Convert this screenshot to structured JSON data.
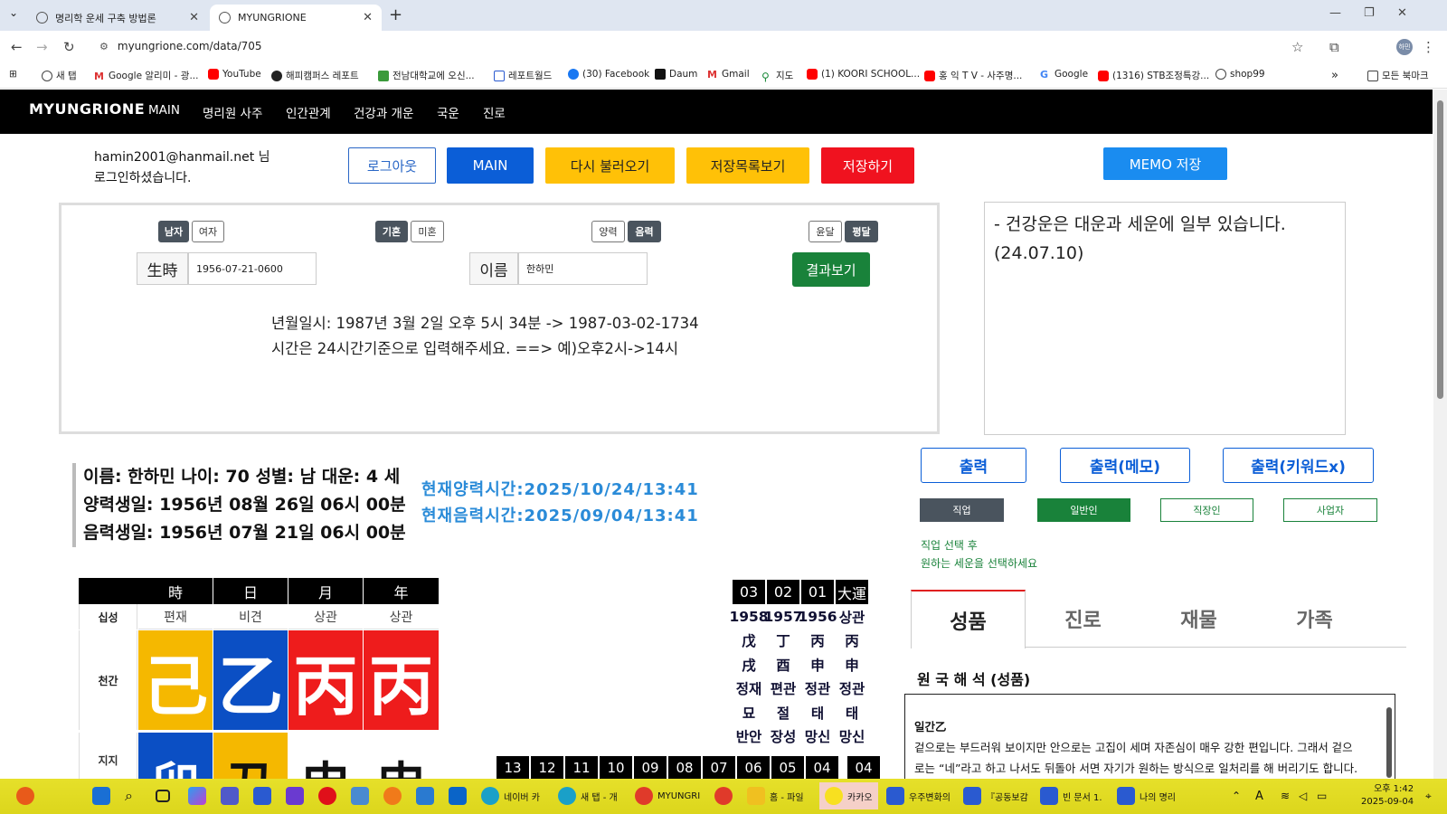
{
  "browser": {
    "tabs": [
      {
        "title": "명리학 운세 구축 방법론",
        "active": false
      },
      {
        "title": "MYUNGRIONE",
        "active": true
      }
    ],
    "url": "myungrione.com/data/705",
    "bookmarks": [
      "새 탭",
      "Google 알리미 - 광...",
      "YouTube",
      "해피캠퍼스 레포트",
      "전남대학교에 오신...",
      "레포트월드",
      "(30) Facebook",
      "Daum",
      "Gmail",
      "지도",
      "(1) KOORI SCHOOL...",
      "홍 익 T V - 사주명...",
      "Google",
      "(1316) STB조정특강...",
      "shop99"
    ],
    "bookmarks_more": "»",
    "all_bookmarks": "모든 북마크"
  },
  "site": {
    "brand": "MYUNGRIONE",
    "nav": [
      "MAIN",
      "명리원 사주",
      "인간관계",
      "건강과 개운",
      "국운",
      "진로"
    ]
  },
  "login": {
    "line1": "hamin2001@hanmail.net 님",
    "line2": "로그인하셨습니다."
  },
  "buttons": {
    "logout": "로그아웃",
    "main": "MAIN",
    "reload": "다시 불러오기",
    "savelist": "저장목록보기",
    "save": "저장하기",
    "memo_save": "MEMO 저장",
    "result": "결과보기"
  },
  "form": {
    "gender": [
      "남자",
      "여자"
    ],
    "marital": [
      "기혼",
      "미혼"
    ],
    "calendar": [
      "양력",
      "음력"
    ],
    "leap": [
      "윤달",
      "평달"
    ],
    "birth_label": "生時",
    "birth_value": "1956-07-21-0600",
    "name_label": "이름",
    "name_value": "한하민",
    "hint1": "년월일시: 1987년 3월 2일 오후 5시 34분 -> 1987-03-02-1734",
    "hint2": "시간은 24시간기준으로 입력해주세요. ==> 예)오후2시->14시"
  },
  "memo": "- 건강운은 대운과 세운에 일부 있습니다.\n(24.07.10)",
  "info": {
    "line1": "이름: 한하민 나이: 70 성별: 남 대운: 4 세",
    "line2": "양력생일: 1956년 08월 26일 06시 00분",
    "line3": "음력생일: 1956년 07월 21일 06시 00분",
    "now_solar": "현재양력시간:2025/10/24/13:41",
    "now_lunar": "현재음력시간:2025/09/04/13:41"
  },
  "print": {
    "print": "출력",
    "print_memo": "출력(메모)",
    "print_kw": "출력(키워드x)"
  },
  "jobs": {
    "label": "직업",
    "options": [
      "일반인",
      "직장인",
      "사업자"
    ],
    "note1": "직업 선택 후",
    "note2": "원하는 세운을 선택하세요"
  },
  "saju": {
    "heads": [
      "時",
      "日",
      "月",
      "年"
    ],
    "row_sipsung_label": "십성",
    "sipsung": [
      "편재",
      "비견",
      "상관",
      "상관"
    ],
    "row_cheongan_label": "천간",
    "cheongan": [
      "己",
      "乙",
      "丙",
      "丙"
    ],
    "cheongan_colors": [
      "#f5b800",
      "#0b4fc4",
      "#ee1c1c",
      "#ee1c1c"
    ],
    "row_jiji_label": "지지",
    "jiji": [
      "卯",
      "丑",
      "申",
      "申"
    ],
    "jiji_colors": [
      "#0b4fc4",
      "#f5b800",
      "#ffffff",
      "#ffffff"
    ]
  },
  "daeun": {
    "heads": [
      "03",
      "02",
      "01",
      "大運"
    ],
    "years": [
      "1958",
      "1957",
      "1956",
      "상관"
    ],
    "stem": [
      "戊",
      "丁",
      "丙",
      "丙"
    ],
    "branch": [
      "戌",
      "酉",
      "申",
      "申"
    ],
    "sipsung": [
      "정재",
      "편관",
      "정관",
      "정관"
    ],
    "unsung": [
      "묘",
      "절",
      "태",
      "태"
    ],
    "sinsal": [
      "반안",
      "장성",
      "망신",
      "망신"
    ],
    "seun_heads": [
      "13",
      "12",
      "11",
      "10",
      "09",
      "08",
      "07",
      "06",
      "05",
      "04",
      "04"
    ]
  },
  "content_tabs": [
    "성품",
    "진로",
    "재물",
    "가족"
  ],
  "interp": {
    "title": "원 국 해 석 (성품)",
    "head": "일간乙",
    "text": "겉으로는 부드러워 보이지만 안으로는 고집이 세며 자존심이 매우 강한 편입니다. 그래서 겉으로는 “네”라고 하고 나서도 뒤돌아 서면 자기가 원하는 방식으로 일처리를 해 버리기도 합니다."
  },
  "taskbar": {
    "items": [
      "네이버 카",
      "새 탭 - 개",
      "MYUNGRI",
      "홈 - 파일",
      "카카오",
      "우주변화의",
      "『공동보감",
      "빈 문서 1.",
      "나의 명리"
    ],
    "clock_time": "오후 1:42",
    "clock_date": "2025-09-04"
  }
}
